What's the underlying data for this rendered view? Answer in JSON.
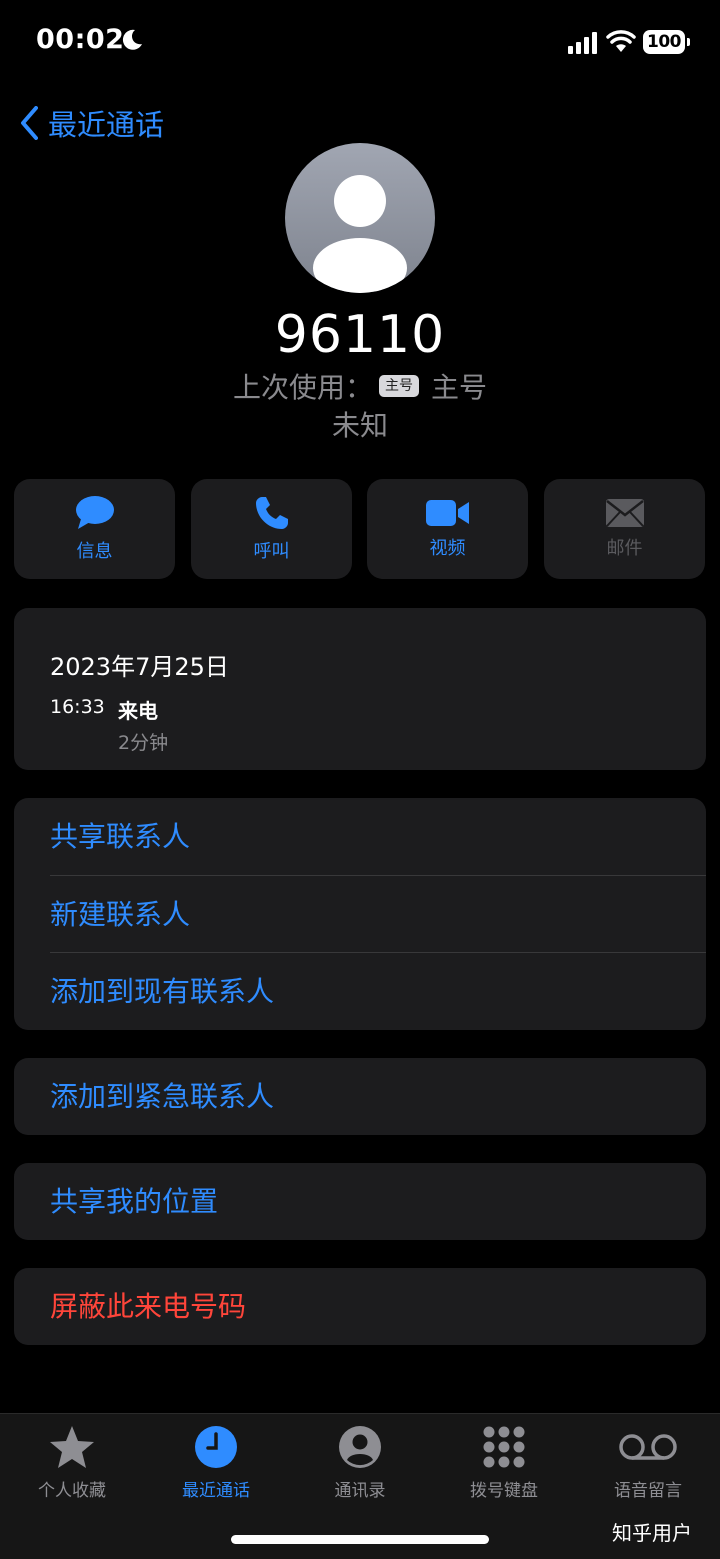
{
  "status_bar": {
    "time": "00:02",
    "battery": "100"
  },
  "nav": {
    "back_label": "最近通话"
  },
  "contact": {
    "number": "96110",
    "last_used_prefix": "上次使用：",
    "sim_badge": "主号",
    "sim_label": "主号",
    "location": "未知"
  },
  "actions": [
    {
      "label": "信息",
      "icon": "message-icon"
    },
    {
      "label": "呼叫",
      "icon": "phone-icon"
    },
    {
      "label": "视频",
      "icon": "video-icon"
    },
    {
      "label": "邮件",
      "icon": "mail-icon"
    }
  ],
  "call_history": {
    "date": "2023年7月25日",
    "time": "16:33",
    "type": "来电",
    "duration": "2分钟"
  },
  "contact_options": [
    "共享联系人",
    "新建联系人",
    "添加到现有联系人"
  ],
  "emergency_option": "添加到紧急联系人",
  "share_location": "共享我的位置",
  "block_option": "屏蔽此来电号码",
  "tabs": [
    {
      "label": "个人收藏",
      "icon": "star-icon"
    },
    {
      "label": "最近通话",
      "icon": "clock-icon"
    },
    {
      "label": "通讯录",
      "icon": "contacts-icon"
    },
    {
      "label": "拨号键盘",
      "icon": "keypad-icon"
    },
    {
      "label": "语音留言",
      "icon": "voicemail-icon"
    }
  ],
  "active_tab": 1,
  "watermark": "知乎用户",
  "colors": {
    "accent": "#2f8cff",
    "danger": "#ff453a",
    "card": "#1c1c1e",
    "secondary_text": "#8a8a8e"
  }
}
